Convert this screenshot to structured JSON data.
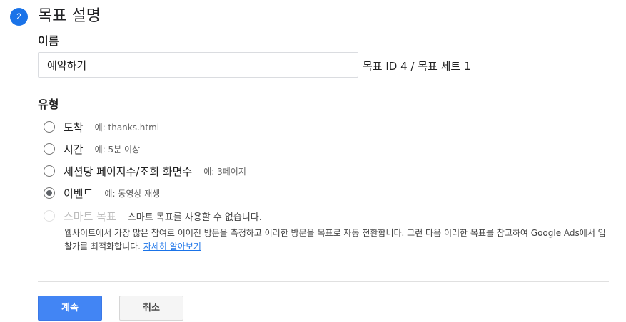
{
  "step": {
    "number": "2",
    "title": "목표 설명"
  },
  "name_section": {
    "label": "이름",
    "input_value": "예약하기",
    "goal_id": "목표 ID 4 / 목표 세트 1"
  },
  "type_section": {
    "label": "유형",
    "options": [
      {
        "label": "도착",
        "example": "예: thanks.html",
        "selected": false,
        "disabled": false
      },
      {
        "label": "시간",
        "example": "예: 5분 이상",
        "selected": false,
        "disabled": false
      },
      {
        "label": "세션당 페이지수/조회 화면수",
        "example": "예: 3페이지",
        "selected": false,
        "disabled": false
      },
      {
        "label": "이벤트",
        "example": "예: 동영상 재생",
        "selected": true,
        "disabled": false
      },
      {
        "label": "스마트 목표",
        "example": "스마트 목표를 사용할 수 없습니다.",
        "selected": false,
        "disabled": true
      }
    ],
    "smart_description": "웹사이트에서 가장 많은 참여로 이어진 방문을 측정하고 이러한 방문을 목표로 자동 전환합니다. 그런 다음 이러한 목표를 참고하여 Google Ads에서 입찰가를 최적화합니다.",
    "learn_more": "자세히 알아보기"
  },
  "buttons": {
    "continue": "계속",
    "cancel": "취소"
  },
  "colors": {
    "accent": "#1a73e8",
    "primary_button": "#4285f4"
  }
}
